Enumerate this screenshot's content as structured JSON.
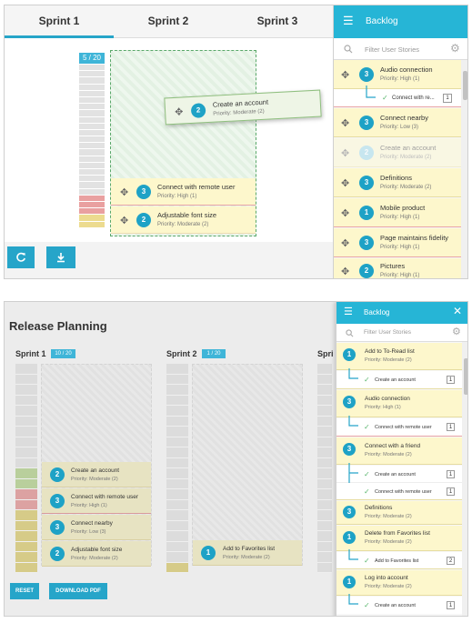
{
  "top": {
    "tabs": [
      "Sprint 1",
      "Sprint 2",
      "Sprint 3"
    ],
    "sprint_counter": "5 / 20",
    "ghost_card": {
      "badge": "2",
      "title": "Create an account",
      "priority": "Priority: Moderate (2)"
    },
    "sprint_cards": [
      {
        "badge": "3",
        "title": "Connect with remote user",
        "priority": "Priority: High (1)"
      },
      {
        "badge": "2",
        "title": "Adjustable font size",
        "priority": "Priority: Moderate (2)"
      }
    ],
    "refresh_icon": "refresh-icon",
    "download_icon": "download-icon",
    "backlog": {
      "title": "Backlog",
      "menu_icon": "hamburger-icon",
      "filter_placeholder": "Filter User Stories",
      "items": [
        {
          "badge": "3",
          "title": "Audio connection",
          "priority": "Priority: High (1)",
          "sub": {
            "label": "Connect with re...",
            "count": "1"
          }
        },
        {
          "badge": "3",
          "title": "Connect nearby",
          "priority": "Priority: Low (3)"
        },
        {
          "badge": "2",
          "title": "Create an account",
          "priority": "Priority: Moderate (2)",
          "faded": true
        },
        {
          "badge": "3",
          "title": "Definitions",
          "priority": "Priority: Moderate (2)"
        },
        {
          "badge": "1",
          "title": "Mobile product",
          "priority": "Priority: High (1)"
        },
        {
          "badge": "3",
          "title": "Page maintains fidelity",
          "priority": "Priority: High (1)"
        },
        {
          "badge": "2",
          "title": "Pictures",
          "priority": "Priority: High (1)"
        }
      ]
    }
  },
  "bottom": {
    "title": "Release Planning",
    "sprints": [
      {
        "label": "Sprint 1",
        "counter": "10 / 20"
      },
      {
        "label": "Sprint 2",
        "counter": "1 / 20"
      },
      {
        "label": "Spri",
        "counter": ""
      }
    ],
    "sprint1_cards": [
      {
        "badge": "2",
        "title": "Create an account",
        "priority": "Priority: Moderate (2)"
      },
      {
        "badge": "3",
        "title": "Connect with remote user",
        "priority": "Priority: High (1)"
      },
      {
        "badge": "3",
        "title": "Connect nearby",
        "priority": "Priority: Low (3)"
      },
      {
        "badge": "2",
        "title": "Adjustable font size",
        "priority": "Priority: Moderate (2)"
      }
    ],
    "sprint2_card": {
      "badge": "1",
      "title": "Add to Favorites list",
      "priority": "Priority: Moderate (2)"
    },
    "reset_label": "RESET",
    "download_label": "DOWNLOAD PDF",
    "backlog": {
      "title": "Backlog",
      "close_icon": "close-icon",
      "filter_placeholder": "Filter User Stories",
      "items": [
        {
          "badge": "1",
          "title": "Add to To-Read list",
          "priority": "Priority: Moderate (2)",
          "subs": [
            {
              "label": "Create an account",
              "count": "1"
            }
          ]
        },
        {
          "badge": "3",
          "title": "Audio connection",
          "priority": "Priority: High (1)",
          "subs": [
            {
              "label": "Connect with remote user",
              "count": "1"
            }
          ]
        },
        {
          "badge": "3",
          "title": "Connect with a friend",
          "priority": "Priority: Moderate (2)",
          "subs": [
            {
              "label": "Create an account",
              "count": "1"
            },
            {
              "label": "Connect with remote user",
              "count": "1"
            }
          ]
        },
        {
          "badge": "3",
          "title": "Definitions",
          "priority": "Priority: Moderate (2)",
          "subs": []
        },
        {
          "badge": "1",
          "title": "Delete from Favorites list",
          "priority": "Priority: Moderate (2)",
          "subs": [
            {
              "label": "Add to Favorites list",
              "count": "2"
            }
          ]
        },
        {
          "badge": "1",
          "title": "Log into account",
          "priority": "Priority: Moderate (2)",
          "subs": [
            {
              "label": "Create an account",
              "count": "1"
            }
          ]
        }
      ]
    }
  },
  "colors": {
    "accent": "#26a5c9",
    "header": "#26b5d6",
    "card": "#fdf7cc",
    "drop_zone": "#e3f1e3"
  }
}
